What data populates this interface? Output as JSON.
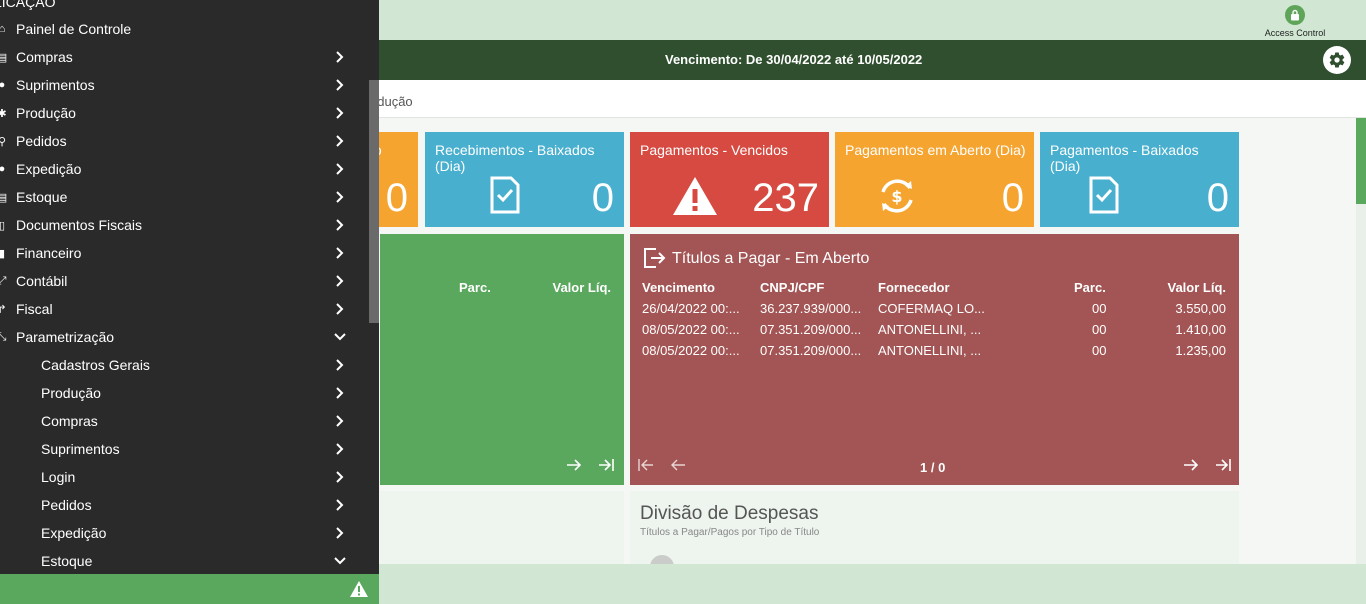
{
  "access_control": {
    "label": "Access Control"
  },
  "header": {
    "period": "Vencimento: De 30/04/2022 até 10/05/2022"
  },
  "breadcrumb": {
    "text": "odução"
  },
  "tiles": [
    {
      "title": "to",
      "value": "0"
    },
    {
      "title": "Recebimentos - Baixados (Dia)",
      "value": "0"
    },
    {
      "title": "Pagamentos - Vencidos",
      "value": "237"
    },
    {
      "title": "Pagamentos em Aberto (Dia)",
      "value": "0"
    },
    {
      "title": "Pagamentos - Baixados (Dia)",
      "value": "0"
    }
  ],
  "panel_green": {
    "columns": [
      "Parc.",
      "Valor Líq."
    ]
  },
  "panel_red": {
    "title": "Títulos a Pagar - Em Aberto",
    "columns": [
      "Vencimento",
      "CNPJ/CPF",
      "Fornecedor",
      "Parc.",
      "Valor Líq."
    ],
    "rows": [
      [
        "26/04/2022 00:...",
        "36.237.939/000...",
        "COFERMAQ LO...",
        "00",
        "3.550,00"
      ],
      [
        "08/05/2022 00:...",
        "07.351.209/000...",
        "ANTONELLINI, ...",
        "00",
        "1.410,00"
      ],
      [
        "08/05/2022 00:...",
        "07.351.209/000...",
        "ANTONELLINI, ...",
        "00",
        "1.235,00"
      ]
    ],
    "pagination": "1 / 0"
  },
  "divisao": {
    "title": "Divisão de Despesas",
    "subtitle": "Títulos a Pagar/Pagos por Tipo de Título"
  },
  "sidebar": {
    "section_title": "LICAÇÃO",
    "items": [
      {
        "label": "Painel de Controle",
        "icon": "home-icon",
        "chevron": "none"
      },
      {
        "label": "Compras",
        "icon": "cart-icon",
        "chevron": "right"
      },
      {
        "label": "Suprimentos",
        "icon": "box-icon",
        "chevron": "right"
      },
      {
        "label": "Produção",
        "icon": "cog-icon",
        "chevron": "right"
      },
      {
        "label": "Pedidos",
        "icon": "pin-icon",
        "chevron": "right"
      },
      {
        "label": "Expedição",
        "icon": "truck-icon",
        "chevron": "right"
      },
      {
        "label": "Estoque",
        "icon": "stock-icon",
        "chevron": "right"
      },
      {
        "label": "Documentos Fiscais",
        "icon": "document-icon",
        "chevron": "right"
      },
      {
        "label": "Financeiro",
        "icon": "money-icon",
        "chevron": "right"
      },
      {
        "label": "Contábil",
        "icon": "chart-icon",
        "chevron": "right"
      },
      {
        "label": "Fiscal",
        "icon": "fiscal-icon",
        "chevron": "right"
      },
      {
        "label": "Parametrização",
        "icon": "wrench-icon",
        "chevron": "down"
      }
    ],
    "subitems": [
      {
        "label": "Cadastros Gerais",
        "chevron": "right"
      },
      {
        "label": "Produção",
        "chevron": "right"
      },
      {
        "label": "Compras",
        "chevron": "right"
      },
      {
        "label": "Suprimentos",
        "chevron": "right"
      },
      {
        "label": "Login",
        "chevron": "right"
      },
      {
        "label": "Pedidos",
        "chevron": "right"
      },
      {
        "label": "Expedição",
        "chevron": "right"
      },
      {
        "label": "Estoque",
        "chevron": "down"
      }
    ]
  }
}
